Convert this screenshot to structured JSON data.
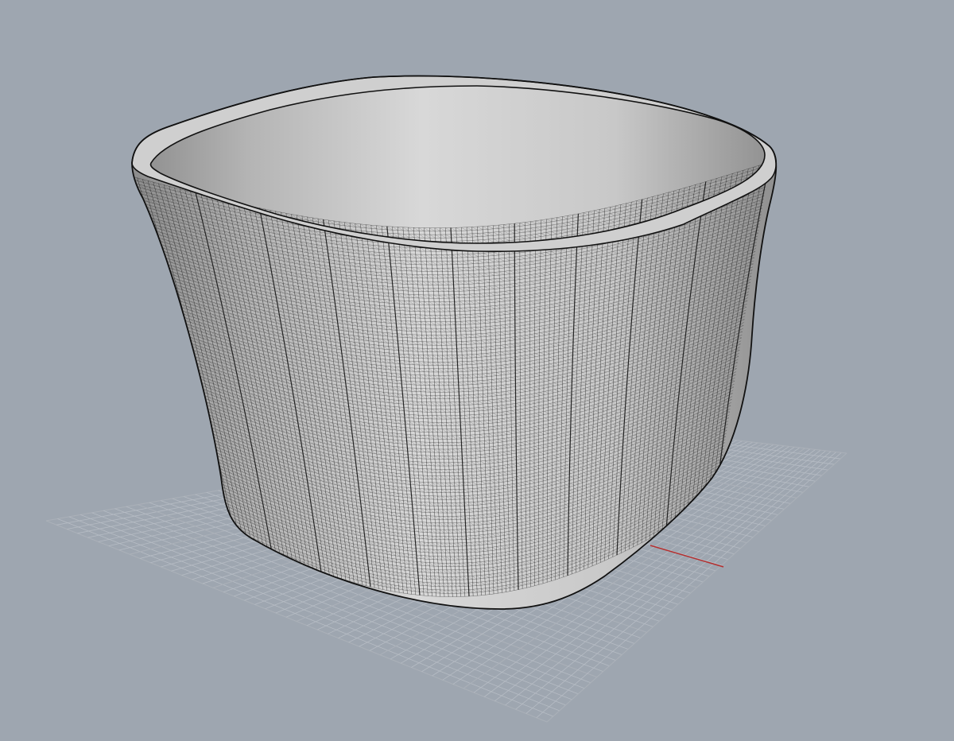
{
  "viewport": {
    "view": "perspective",
    "display_mode": "shaded-with-mesh-wireframe",
    "background_color": "#9ea6b0",
    "grid_color": "#b6bcc4",
    "grid_major_color": "#aab0b8",
    "axis_x_color": "#b33030",
    "axis_y_color": "#3a8a3a",
    "mesh_line_color": "#1c1c1c",
    "surface_light_color": "#e9e9e9",
    "surface_dark_color": "#8a8a8a"
  },
  "model": {
    "object_type": "mesh",
    "shape": "rounded-square-vessel"
  }
}
